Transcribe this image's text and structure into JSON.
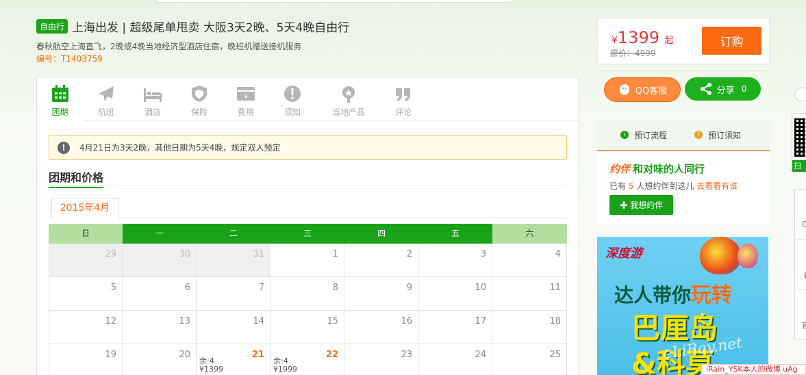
{
  "header": {
    "badge": "自由行",
    "title": "上海出发 | 超级尾单甩卖 大阪3天2晚、5天4晚自由行",
    "subtitle": "春秋航空上海直飞，2晚或4晚当地经济型酒店住宿，晚班机赠送接机服务",
    "code": "编号：T1403759"
  },
  "price": {
    "currency": "¥",
    "value": "1399",
    "suffix": "起",
    "original": "原价：4999",
    "order_label": "订购"
  },
  "nav_tabs": [
    {
      "label": "团期",
      "icon": "calendar-icon",
      "active": true
    },
    {
      "label": "航班",
      "icon": "plane-icon"
    },
    {
      "label": "酒店",
      "icon": "bed-icon"
    },
    {
      "label": "保险",
      "icon": "shield-icon"
    },
    {
      "label": "费用",
      "icon": "money-icon"
    },
    {
      "label": "须知",
      "icon": "warning-icon"
    },
    {
      "label": "当地产品",
      "icon": "local-product-icon"
    },
    {
      "label": "评论",
      "icon": "quote-icon"
    }
  ],
  "notice": "4月21日为3天2晚，其他日期为5天4晚，规定双人预定",
  "section_title": "团期和价格",
  "month_tab": "2015年4月",
  "calendar": {
    "weekdays": [
      "日",
      "一",
      "二",
      "三",
      "四",
      "五",
      "六"
    ],
    "rows": [
      [
        {
          "d": "29",
          "prev": true
        },
        {
          "d": "30",
          "prev": true
        },
        {
          "d": "31",
          "prev": true
        },
        {
          "d": "1"
        },
        {
          "d": "2"
        },
        {
          "d": "3"
        },
        {
          "d": "4"
        }
      ],
      [
        {
          "d": "5"
        },
        {
          "d": "6"
        },
        {
          "d": "7"
        },
        {
          "d": "8"
        },
        {
          "d": "9"
        },
        {
          "d": "10"
        },
        {
          "d": "11"
        }
      ],
      [
        {
          "d": "12"
        },
        {
          "d": "13"
        },
        {
          "d": "14"
        },
        {
          "d": "15"
        },
        {
          "d": "16"
        },
        {
          "d": "17"
        },
        {
          "d": "18"
        }
      ],
      [
        {
          "d": "19"
        },
        {
          "d": "20"
        },
        {
          "d": "21",
          "hot": true,
          "left": "余:4",
          "price": "¥1399"
        },
        {
          "d": "22",
          "hot": true,
          "left": "余:4",
          "price": "¥1999"
        },
        {
          "d": "23"
        },
        {
          "d": "24"
        },
        {
          "d": "25"
        }
      ]
    ]
  },
  "right": {
    "qq_label": "QQ客服",
    "share_label": "分享",
    "share_count": "0",
    "process_label": "预订流程",
    "booking_notice_label": "预订须知",
    "buddy_logo": "约伴",
    "buddy_title": "和对味的人同行",
    "buddy_pre": "已有",
    "buddy_count": "5",
    "buddy_mid": "人想约伴到这儿",
    "buddy_link": "去看看有谁",
    "buddy_btn": "我想约伴"
  },
  "ad": {
    "brand": "深度游",
    "line1_a": "达人带你",
    "line1_b": "玩转",
    "line2": "巴厘岛",
    "line3": "&科莫"
  },
  "watermark": "eLiBay.net",
  "float_note": "iRain_YSK本人的微博 uAg",
  "side": {
    "scan": "扫",
    "items": [
      "G",
      "彳",
      "官"
    ]
  }
}
